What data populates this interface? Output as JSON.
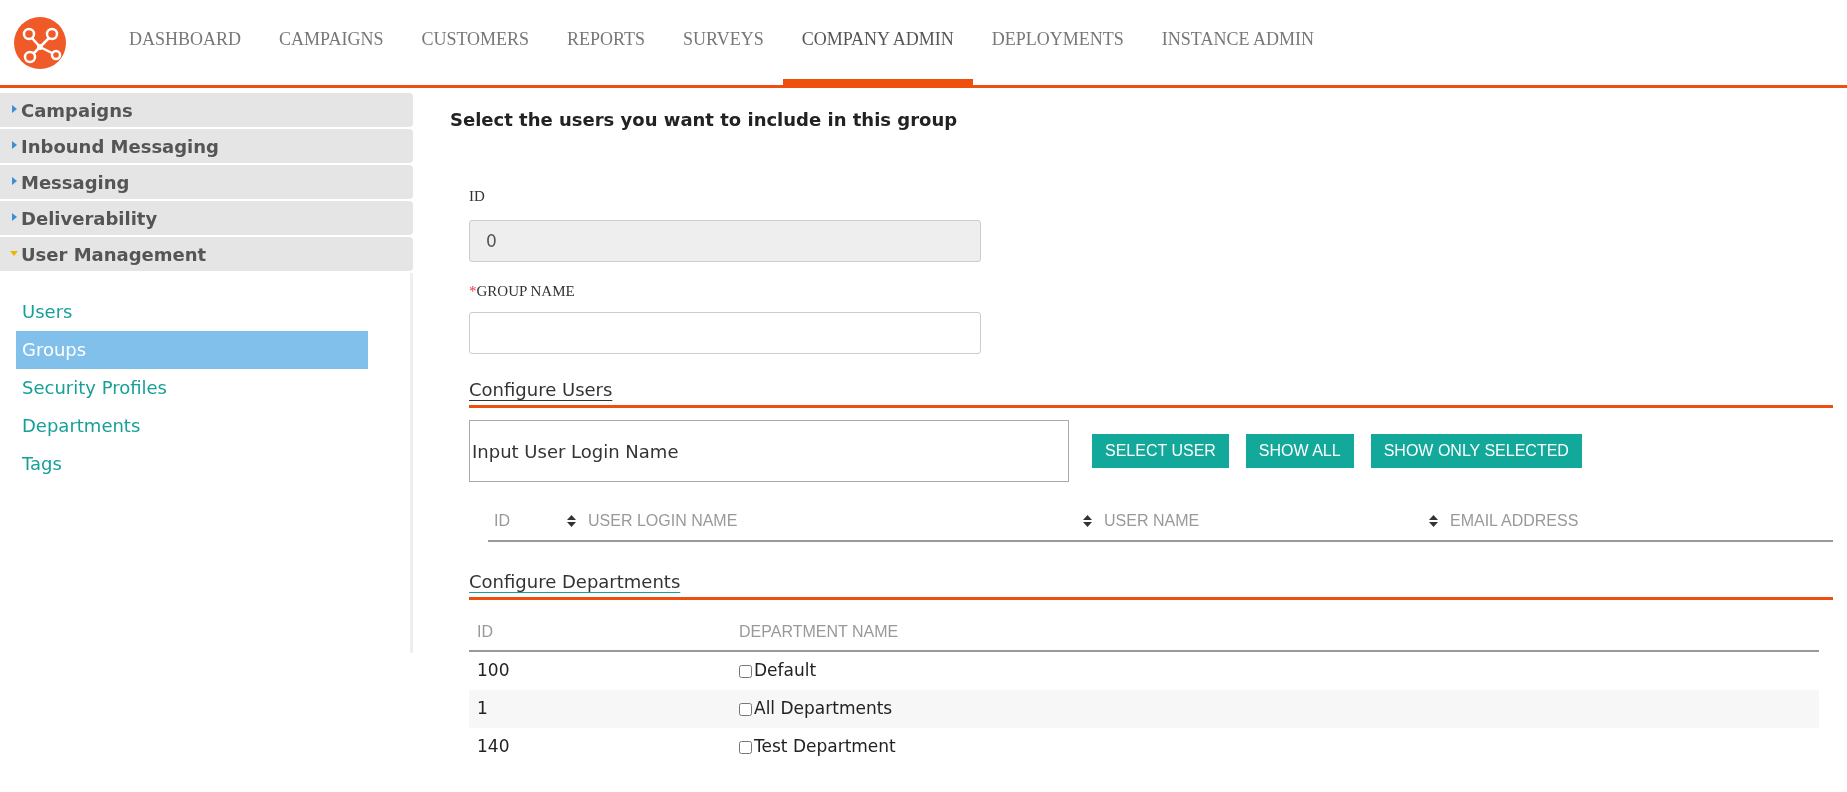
{
  "nav": {
    "tabs": [
      {
        "label": "DASHBOARD",
        "selected": false
      },
      {
        "label": "CAMPAIGNS",
        "selected": false
      },
      {
        "label": "CUSTOMERS",
        "selected": false
      },
      {
        "label": "REPORTS",
        "selected": false
      },
      {
        "label": "SURVEYS",
        "selected": false
      },
      {
        "label": "COMPANY ADMIN",
        "selected": true
      },
      {
        "label": "DEPLOYMENTS",
        "selected": false
      },
      {
        "label": "INSTANCE ADMIN",
        "selected": false
      }
    ]
  },
  "sidebar": {
    "sections": [
      {
        "label": "Campaigns",
        "expanded": false
      },
      {
        "label": "Inbound Messaging",
        "expanded": false
      },
      {
        "label": "Messaging",
        "expanded": false
      },
      {
        "label": "Deliverability",
        "expanded": false
      },
      {
        "label": "User Management",
        "expanded": true,
        "items": [
          {
            "label": "Users",
            "selected": false
          },
          {
            "label": "Groups",
            "selected": true
          },
          {
            "label": "Security Profiles",
            "selected": false
          },
          {
            "label": "Departments",
            "selected": false
          },
          {
            "label": "Tags",
            "selected": false
          }
        ]
      }
    ]
  },
  "form": {
    "heading": "Select the users you want to include in this group",
    "id_field": {
      "label": "ID",
      "value": "0"
    },
    "group_name_field": {
      "required_mark": "*",
      "label": "GROUP NAME"
    },
    "configure_users": {
      "title": "Configure Users",
      "search": {
        "placeholder": "Input User Login Name"
      },
      "buttons": [
        "SELECT USER",
        "SHOW ALL",
        "SHOW ONLY SELECTED"
      ],
      "columns": [
        "ID",
        "USER LOGIN NAME",
        "USER NAME",
        "EMAIL ADDRESS"
      ]
    },
    "configure_departments": {
      "title": "Configure Departments",
      "columns": [
        "ID",
        "DEPARTMENT NAME"
      ],
      "rows": [
        {
          "id": "100",
          "name": "Default",
          "checked": false
        },
        {
          "id": "1",
          "name": "All Departments",
          "checked": false
        },
        {
          "id": "140",
          "name": "Test Department",
          "checked": false
        }
      ]
    }
  }
}
